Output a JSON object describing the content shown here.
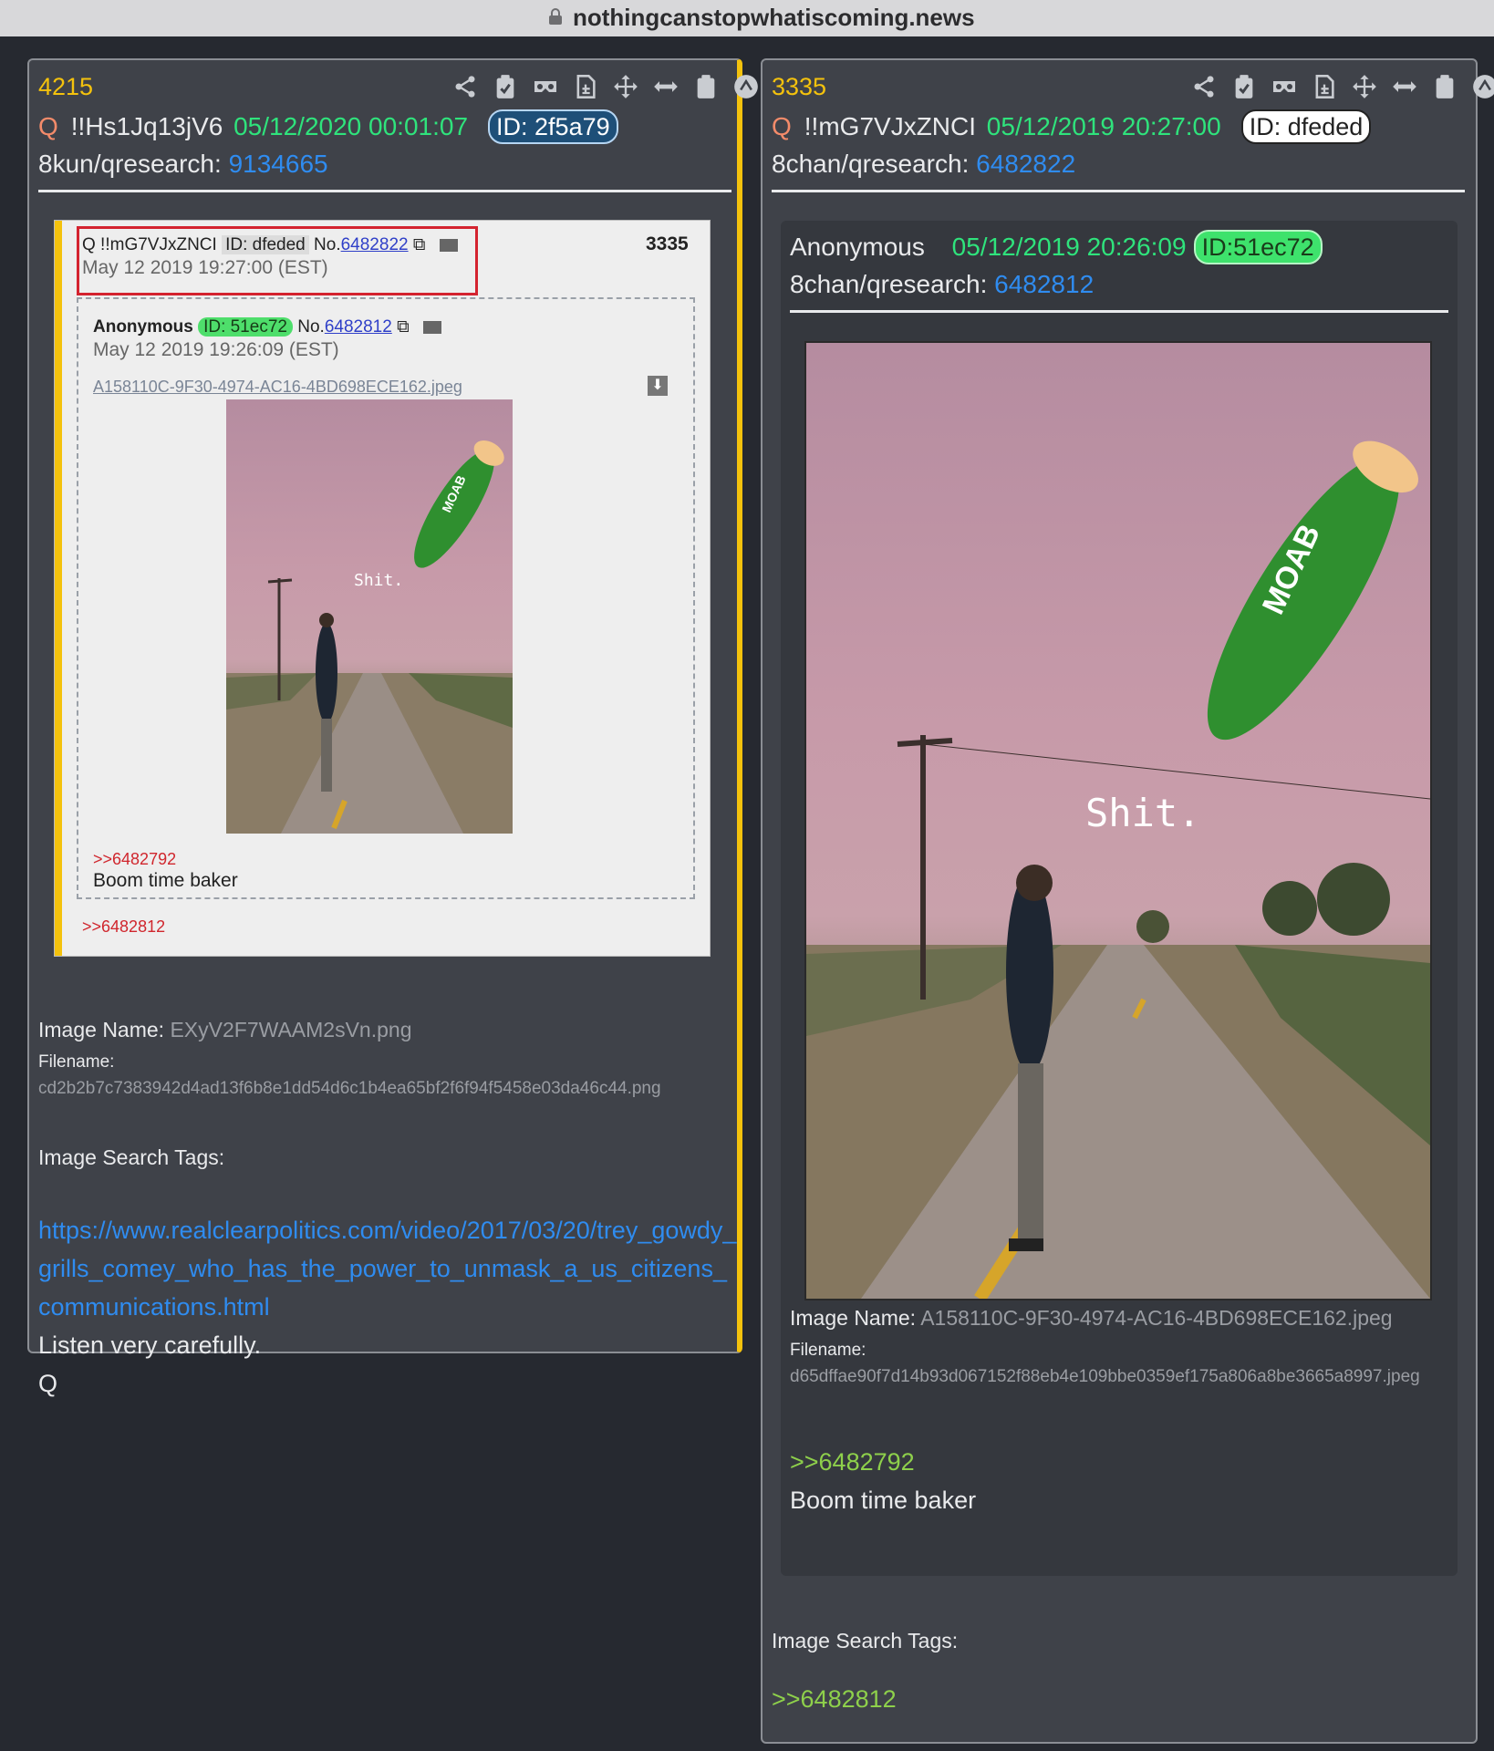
{
  "browser": {
    "url": "nothingcanstopwhatiscoming.news"
  },
  "left_post": {
    "number": "4215",
    "q": "Q",
    "trip": "!!Hs1Jq13jV6",
    "date": "05/12/2020 00:01:07",
    "id": "ID: 2f5a79",
    "board": "8kun/qresearch:",
    "board_link": "9134665",
    "screenshot": {
      "header_trip": "Q !!mG7VJxZNCI",
      "header_id": "ID: dfeded",
      "header_no": "No.",
      "header_no_link": "6482822",
      "header_date": "May 12 2019 19:27:00 (EST)",
      "header_postnum": "3335",
      "inner_name": "Anonymous",
      "inner_id": "ID: 51ec72",
      "inner_no": "No.",
      "inner_no_link": "6482812",
      "inner_date": "May 12 2019 19:26:09 (EST)",
      "inner_file": "A158110C-9F30-4974-AC16-4BD698ECE162.jpeg",
      "image_text": "Shit.",
      "image_bomb_text": "MOAB",
      "inner_quote": ">>6482792",
      "inner_body": "Boom time baker",
      "outer_quote": ">>6482812"
    },
    "image_name_label": "Image Name:",
    "image_name": "EXyV2F7WAAM2sVn.png",
    "filename_label": "Filename:",
    "filename": "cd2b2b7c7383942d4ad13f6b8e1dd54d6c1b4ea65bf2f6f94f5458e03da46c44.png",
    "tags_label": "Image Search Tags:",
    "link": "https://www.realclearpolitics.com/video/2017/03/20/trey_gowdy_grills_comey_who_has_the_power_to_unmask_a_us_citizens_communications.html",
    "body_line1": "Listen very carefully.",
    "body_line2": "Q"
  },
  "right_post": {
    "number": "3335",
    "q": "Q",
    "trip": "!!mG7VJxZNCI",
    "date": "05/12/2019 20:27:00",
    "id": "ID: dfeded",
    "board": "8chan/qresearch:",
    "board_link": "6482822",
    "inner": {
      "name": "Anonymous",
      "date": "05/12/2019 20:26:09",
      "id": "ID:51ec72",
      "board": "8chan/qresearch:",
      "board_link": "6482812",
      "image_text": "Shit.",
      "image_bomb_text": "MOAB",
      "image_name_label": "Image Name:",
      "image_name": "A158110C-9F30-4974-AC16-4BD698ECE162.jpeg",
      "filename_label": "Filename:",
      "filename": "d65dffae90f7d14b93d067152f88eb4e109bbe0359ef175a806a8be3665a8997.jpeg",
      "quote": ">>6482792",
      "body": "Boom time baker"
    },
    "tags_label": "Image Search Tags:",
    "quote": ">>6482812"
  },
  "icons": [
    "share-icon",
    "clipboard-check-icon",
    "vr-glasses-icon",
    "document-icon",
    "move-icon",
    "resize-horizontal-icon",
    "clipboard-icon",
    "up-arrow-circle-icon"
  ],
  "colors": {
    "accent_yellow": "#f4c20d",
    "link_blue": "#2f8cf0",
    "date_green": "#2fe37c",
    "greentext": "#8ed04b",
    "q_orange": "#f38b6a"
  }
}
